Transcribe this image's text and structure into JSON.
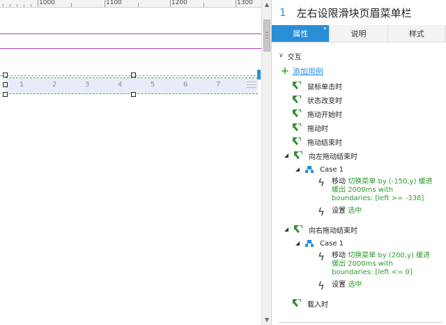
{
  "ruler": {
    "ticks": [
      "1000",
      "1100",
      "1200",
      "1300"
    ]
  },
  "canvas": {
    "menu_numbers": [
      "1",
      "2",
      "3",
      "4",
      "5",
      "6",
      "7"
    ]
  },
  "panel": {
    "page_number": "1",
    "page_title": "左右设限滑块页眉菜单栏",
    "tabs": [
      {
        "label": "属性",
        "active": true,
        "badge": "*"
      },
      {
        "label": "说明",
        "active": false
      },
      {
        "label": "样式",
        "active": false
      }
    ],
    "section_label": "交互",
    "add_case_label": "添加用例",
    "events": {
      "mouse_click": "鼠标单击时",
      "state_change": "状态改变时",
      "drag_start": "拖动开始时",
      "drag": "拖动时",
      "drag_end": "拖动结束时",
      "drag_left_end": "向左拖动结束时",
      "drag_right_end": "向右拖动结束时",
      "load": "载入时"
    },
    "case_left": {
      "name": "Case 1",
      "move_verb": "移动",
      "move_detail": "切换菜单 by (-150,y) 缓进缓出 2000ms with boundaries: [left >= -338]",
      "set_verb": "设置",
      "set_detail": "选中"
    },
    "case_right": {
      "name": "Case 1",
      "move_verb": "移动",
      "move_detail": "切换菜单 by (200,y) 缓进缓出 2000ms with boundaries: [left <= 0]",
      "set_verb": "设置",
      "set_detail": "选中"
    }
  },
  "colors": {
    "accent": "#2a8ed6",
    "guide": "#b23cc4",
    "selection": "#3ac43a",
    "action_target": "#2b9a2b"
  },
  "icons": {
    "event": "event-cursor-icon",
    "case": "case-tree-icon",
    "action": "lightning-icon",
    "add": "plus-icon"
  }
}
